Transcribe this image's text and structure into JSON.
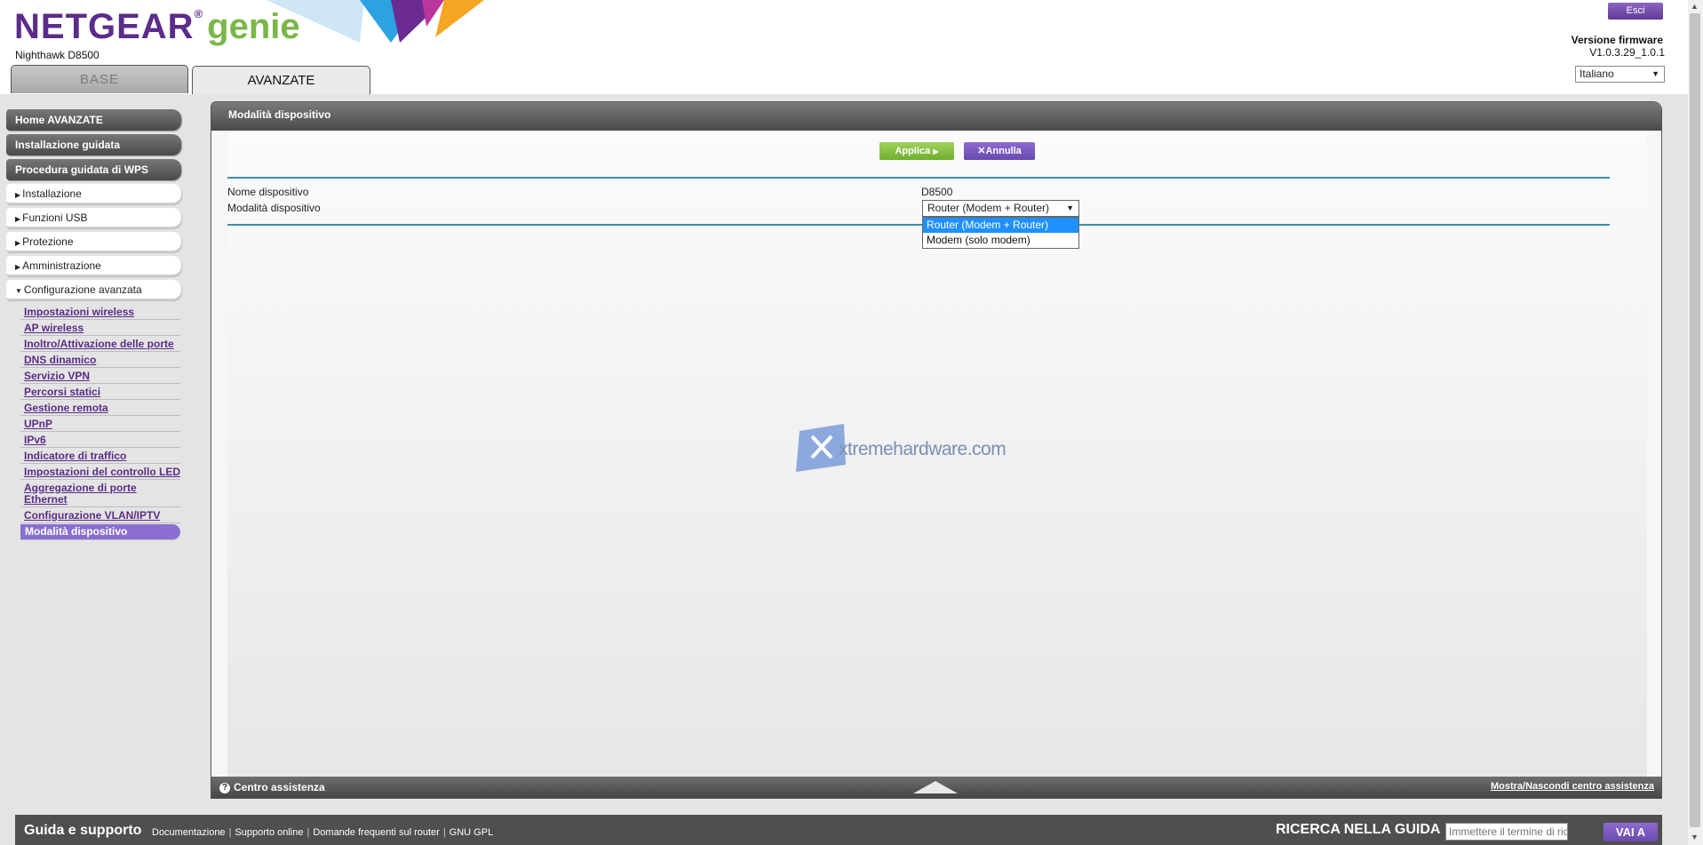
{
  "header": {
    "brand": "NETGEAR",
    "brand_reg": "®",
    "product": "genie",
    "model": "Nighthawk D8500",
    "tabs": [
      {
        "label": "BASE",
        "active": false
      },
      {
        "label": "AVANZATE",
        "active": true
      }
    ],
    "logout_label": "Esci",
    "firmware_label": "Versione firmware",
    "firmware_version": "V1.0.3.29_1.0.1",
    "language": "Italiano",
    "colors": {
      "brand": "#5b2c8a",
      "genie": "#7ab648"
    }
  },
  "sidebar": {
    "buttons": [
      {
        "label": "Home AVANZATE"
      },
      {
        "label": "Installazione guidata"
      },
      {
        "label": "Procedura guidata di WPS"
      }
    ],
    "sections": [
      {
        "label": "Installazione",
        "expanded": false
      },
      {
        "label": "Funzioni USB",
        "expanded": false
      },
      {
        "label": "Protezione",
        "expanded": false
      },
      {
        "label": "Amministrazione",
        "expanded": false
      },
      {
        "label": "Configurazione avanzata",
        "expanded": true
      }
    ],
    "submenu": [
      {
        "label": "Impostazioni wireless"
      },
      {
        "label": "AP wireless"
      },
      {
        "label": "Inoltro/Attivazione delle porte"
      },
      {
        "label": "DNS dinamico"
      },
      {
        "label": "Servizio VPN"
      },
      {
        "label": "Percorsi statici"
      },
      {
        "label": "Gestione remota"
      },
      {
        "label": "UPnP"
      },
      {
        "label": "IPv6"
      },
      {
        "label": "Indicatore di traffico"
      },
      {
        "label": "Impostazioni del controllo LED"
      },
      {
        "label": "Aggregazione di porte Ethernet"
      },
      {
        "label": "Configurazione VLAN/IPTV"
      },
      {
        "label": "Modalità dispositivo",
        "active": true
      }
    ]
  },
  "panel": {
    "title": "Modalità dispositivo",
    "apply_label": "Applica",
    "cancel_label": "Annulla",
    "device_name_label": "Nome dispositivo",
    "device_name_value": "D8500",
    "device_mode_label": "Modalità dispositivo",
    "device_mode_selected": "Router (Modem + Router)",
    "device_mode_options": [
      "Router (Modem + Router)",
      "Modem (solo modem)"
    ],
    "watermark": "xtremehardware.com",
    "help_label": "Centro assistenza",
    "help_toggle": "Mostra/Nascondi centro assistenza"
  },
  "footer": {
    "title": "Guida e supporto",
    "links": [
      "Documentazione",
      "Supporto online",
      "Domande frequenti sul router",
      "GNU GPL"
    ],
    "search_title": "RICERCA NELLA GUIDA",
    "search_placeholder": "Immettere il termine di ricerca",
    "search_button": "VAI A"
  }
}
